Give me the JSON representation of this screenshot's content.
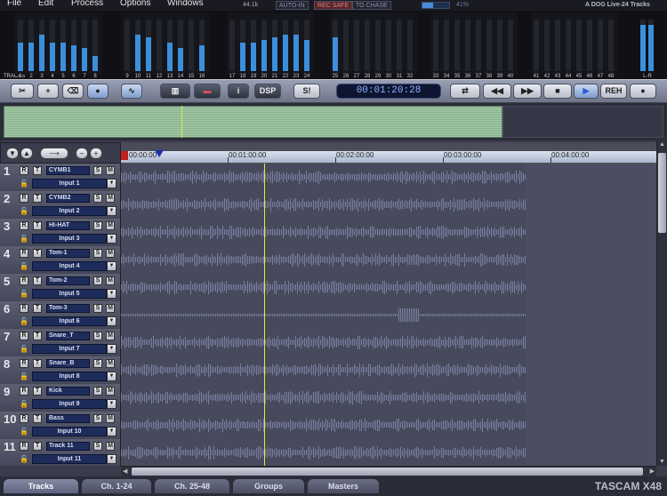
{
  "menu": [
    "File",
    "Edit",
    "Process",
    "Options",
    "Windows"
  ],
  "status": {
    "rate": "44.1k",
    "auto_in": "AUTO-IN",
    "rec_safe": "REC SAFE",
    "to_chase": "TO CHASE",
    "cpu_pct": "41%",
    "cpu_fraction": 0.41,
    "project": "A DOG Live-24 Tracks"
  },
  "meters": {
    "tracks_label": "TRACKS",
    "lr_label": "L-R",
    "levels": [
      0.55,
      0.55,
      0.7,
      0.55,
      0.55,
      0.5,
      0.45,
      0.3,
      0,
      0.7,
      0.65,
      0,
      0.55,
      0.45,
      0,
      0.5,
      0,
      0.55,
      0.55,
      0.6,
      0.65,
      0.7,
      0.7,
      0.6,
      0.65,
      0,
      0,
      0,
      0,
      0,
      0,
      0,
      0,
      0,
      0,
      0,
      0,
      0,
      0,
      0,
      0,
      0,
      0,
      0,
      0,
      0,
      0,
      0
    ],
    "lr": [
      0.9,
      0.9
    ]
  },
  "toolbar": {
    "dsp": "DSP",
    "solo_clear": "S!",
    "timecode": "00:01:20:28",
    "reh": "REH"
  },
  "ruler": [
    "00:00:00",
    "00:01:00:00",
    "00:02:00:00",
    "00:03:00:00",
    "00:04:00:00"
  ],
  "tracks": [
    {
      "num": "1",
      "name": "CYMB1",
      "input": "Input 1"
    },
    {
      "num": "2",
      "name": "CYMB2",
      "input": "Input 2"
    },
    {
      "num": "3",
      "name": "HI-HAT",
      "input": "Input 3"
    },
    {
      "num": "4",
      "name": "Tom-1",
      "input": "Input 4"
    },
    {
      "num": "5",
      "name": "Tom-2",
      "input": "Input 5"
    },
    {
      "num": "6",
      "name": "Tom-3",
      "input": "Input 6"
    },
    {
      "num": "7",
      "name": "Snare_T",
      "input": "Input 7"
    },
    {
      "num": "8",
      "name": "Snare_B",
      "input": "Input 8"
    },
    {
      "num": "9",
      "name": "Kick",
      "input": "Input 9"
    },
    {
      "num": "10",
      "name": "Bass",
      "input": "Input 10"
    },
    {
      "num": "11",
      "name": "Track 11",
      "input": "Input 11"
    }
  ],
  "tabs": [
    "Tracks",
    "Ch. 1-24",
    "Ch. 25-48",
    "Groups",
    "Masters"
  ],
  "brand": "TASCAM X48",
  "colors": {
    "meter": "#3b8fdc",
    "playhead": "#e2e640",
    "overview": "#a2c8a6"
  }
}
